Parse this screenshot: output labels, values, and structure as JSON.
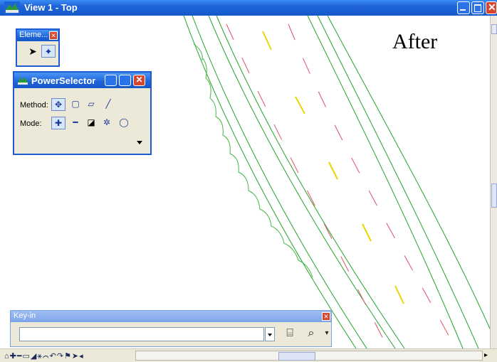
{
  "window": {
    "title": "View 1 - Top"
  },
  "canvas": {
    "annotation": "After"
  },
  "element_toolbox": {
    "title": "Eleme...",
    "tools": [
      "element-selection",
      "power-selector"
    ]
  },
  "power_selector": {
    "title": "PowerSelector",
    "method_label": "Method:",
    "mode_label": "Mode:",
    "method_tools": [
      "individual",
      "block",
      "shape",
      "line"
    ],
    "mode_tools": [
      "add",
      "subtract",
      "invert",
      "new",
      "clear"
    ]
  },
  "keyin": {
    "title": "Key-in",
    "value": ""
  },
  "colors": {
    "titlebar": "#1e63d8",
    "line_green": "#26a326",
    "line_red": "#e0506a",
    "line_yellow": "#e6d800",
    "close": "#d6452c"
  }
}
